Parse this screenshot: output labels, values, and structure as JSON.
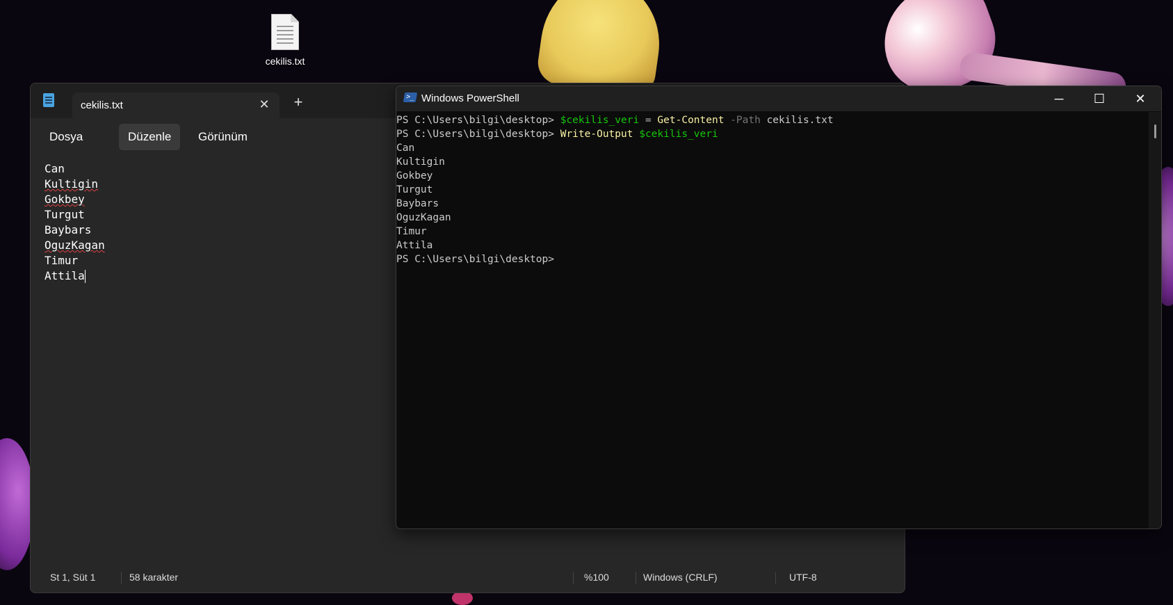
{
  "desktop": {
    "icon_label": "cekilis.txt"
  },
  "notepad": {
    "tab_title": "cekilis.txt",
    "close_tab_symbol": "✕",
    "new_tab_symbol": "+",
    "menu": [
      "Dosya",
      "Düzenle",
      "Görünüm"
    ],
    "active_menu": "Düzenle",
    "lines": [
      "Can",
      "Kultigin",
      "Gokbey",
      "Turgut",
      "Baybars",
      "OguzKagan",
      "Timur",
      "Attila"
    ],
    "status": {
      "position": "St 1, Süt 1",
      "char_count": "58 karakter",
      "zoom": "%100",
      "line_ending": "Windows (CRLF)",
      "encoding": "UTF-8"
    }
  },
  "powershell": {
    "title": "Windows PowerShell",
    "minimize_symbol": "─",
    "maximize_symbol": "☐",
    "close_symbol": "✕",
    "prompt": "PS C:\\Users\\bilgi\\desktop>",
    "cmd1": {
      "var": "$cekilis_veri",
      "op": "=",
      "cmd": "Get-Content",
      "param": "-Path",
      "arg": "cekilis.txt"
    },
    "cmd2": {
      "cmd": "Write-Output",
      "var": "$cekilis_veri"
    },
    "output": [
      "Can",
      "Kultigin",
      "Gokbey",
      "Turgut",
      "Baybars",
      "OguzKagan",
      "Timur",
      "Attila"
    ]
  },
  "colors": {
    "ps_variable": "#16c60c",
    "ps_command": "#f9f1a5",
    "ps_parameter": "#767676",
    "notepad_bg": "#272727",
    "ps_bg": "#0c0c0c"
  },
  "icons": {
    "notepad_app": "notepad-icon",
    "powershell_app": "powershell-icon",
    "desktop_file": "text-file-icon"
  }
}
